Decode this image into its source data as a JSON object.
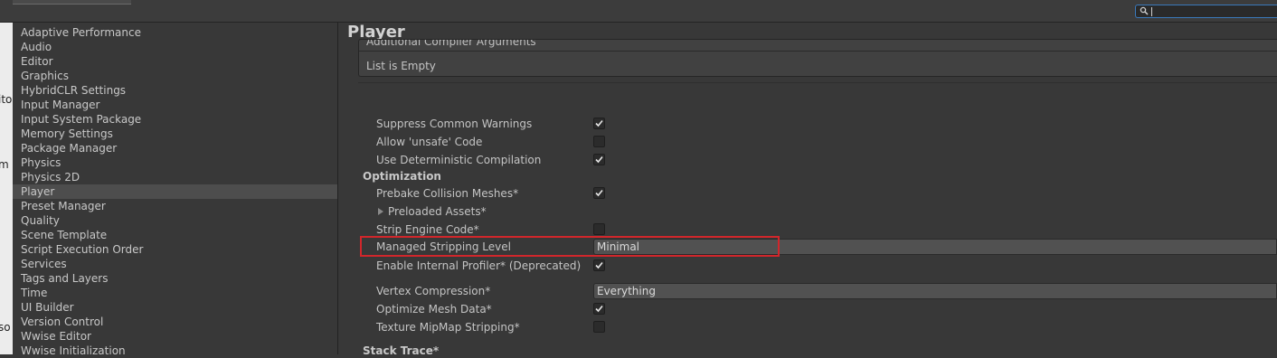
{
  "background_window": {
    "fragments": [
      "ito",
      "m",
      "so"
    ]
  },
  "search": {
    "value": ""
  },
  "sidebar": {
    "items": [
      {
        "label": "Adaptive Performance"
      },
      {
        "label": "Audio"
      },
      {
        "label": "Editor"
      },
      {
        "label": "Graphics"
      },
      {
        "label": "HybridCLR Settings"
      },
      {
        "label": "Input Manager"
      },
      {
        "label": "Input System Package"
      },
      {
        "label": "Memory Settings"
      },
      {
        "label": "Package Manager"
      },
      {
        "label": "Physics"
      },
      {
        "label": "Physics 2D"
      },
      {
        "label": "Player",
        "selected": true
      },
      {
        "label": "Preset Manager"
      },
      {
        "label": "Quality"
      },
      {
        "label": "Scene Template"
      },
      {
        "label": "Script Execution Order"
      },
      {
        "label": "Services"
      },
      {
        "label": "Tags and Layers"
      },
      {
        "label": "Time"
      },
      {
        "label": "UI Builder"
      },
      {
        "label": "Version Control"
      },
      {
        "label": "Wwise Editor"
      },
      {
        "label": "Wwise Initialization"
      }
    ]
  },
  "main": {
    "title": "Player",
    "compiler_args": {
      "header": "Additional Compiler Arguments",
      "empty_text": "List is Empty"
    },
    "settings": {
      "suppress_warnings": {
        "label": "Suppress Common Warnings",
        "checked": true
      },
      "allow_unsafe": {
        "label": "Allow 'unsafe' Code",
        "checked": false
      },
      "deterministic": {
        "label": "Use Deterministic Compilation",
        "checked": true
      }
    },
    "optimization": {
      "header": "Optimization",
      "prebake": {
        "label": "Prebake Collision Meshes*",
        "checked": true
      },
      "preloaded_assets": {
        "label": "Preloaded Assets*"
      },
      "strip_engine": {
        "label": "Strip Engine Code*",
        "checked": false
      },
      "managed_stripping": {
        "label": "Managed Stripping Level",
        "value": "Minimal"
      },
      "internal_profiler": {
        "label": "Enable Internal Profiler* (Deprecated)",
        "checked": true
      },
      "vertex_compression": {
        "label": "Vertex Compression*",
        "value": "Everything"
      },
      "optimize_mesh": {
        "label": "Optimize Mesh Data*",
        "checked": true
      },
      "texture_mipmap": {
        "label": "Texture MipMap Stripping*",
        "checked": false
      }
    },
    "stack_trace": {
      "header": "Stack Trace*"
    }
  },
  "colors": {
    "highlight": "#d1262b",
    "selection": "#4d4d4d",
    "search_focus": "#3a79bb"
  }
}
